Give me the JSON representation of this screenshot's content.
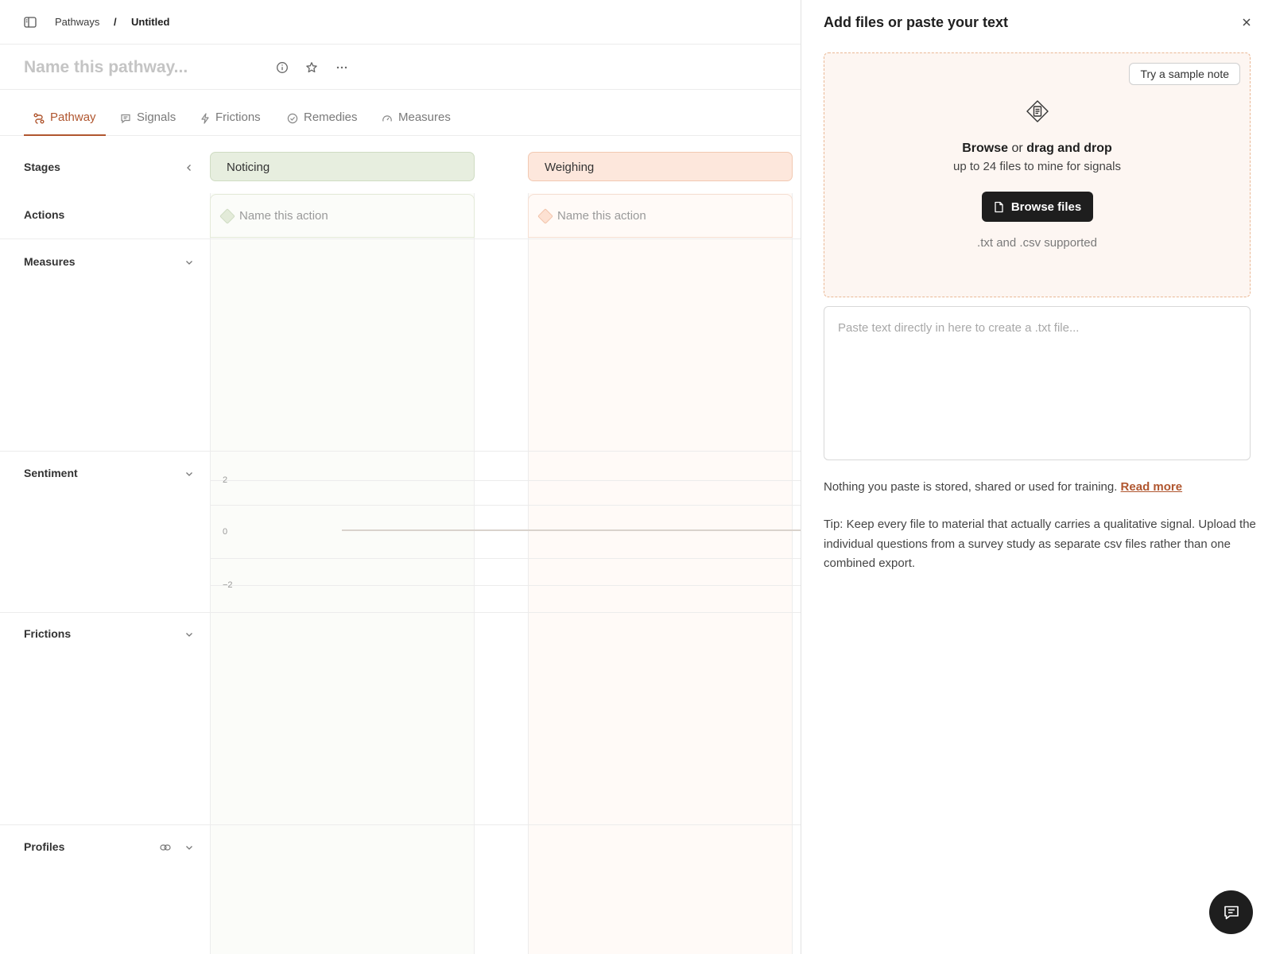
{
  "breadcrumb": {
    "root": "Pathways",
    "separator": "/",
    "current": "Untitled"
  },
  "title": {
    "placeholder": "Name this pathway..."
  },
  "tabs": [
    {
      "label": "Pathway",
      "icon": "pathway-icon",
      "active": true
    },
    {
      "label": "Signals",
      "icon": "chat-bubble-icon"
    },
    {
      "label": "Frictions",
      "icon": "bolt-icon"
    },
    {
      "label": "Remedies",
      "icon": "check-circle-icon"
    },
    {
      "label": "Measures",
      "icon": "gauge-icon"
    }
  ],
  "rows": {
    "stages": "Stages",
    "actions": "Actions",
    "measures": "Measures",
    "sentiment": "Sentiment",
    "frictions": "Frictions",
    "profiles": "Profiles"
  },
  "stages": [
    {
      "name": "Noticing",
      "color": "#e7eedf"
    },
    {
      "name": "Weighing",
      "color": "#fde7dc"
    }
  ],
  "actions": [
    {
      "placeholder": "Name this action"
    },
    {
      "placeholder": "Name this action"
    }
  ],
  "sentiment_ticks": [
    "2",
    "0",
    "−2"
  ],
  "panel": {
    "title": "Add files or paste your text",
    "sample_button": "Try a sample note",
    "browse_word": "Browse",
    "or_word": "or",
    "drag_word": "drag and drop",
    "limit_text": "up to 24 files to mine for signals",
    "browse_button": "Browse files",
    "supported": ".txt and .csv supported",
    "paste_placeholder": "Paste text directly in here to create a .txt file...",
    "privacy_text": "Nothing you paste is stored, shared or used for training.",
    "read_more": "Read more",
    "tip": "Tip: Keep every file to material that actually carries a qualitative signal. Upload the individual questions from a survey study as separate csv files rather than one combined export."
  },
  "colors": {
    "accent": "#b0562f",
    "dark": "#1e1e1e"
  }
}
